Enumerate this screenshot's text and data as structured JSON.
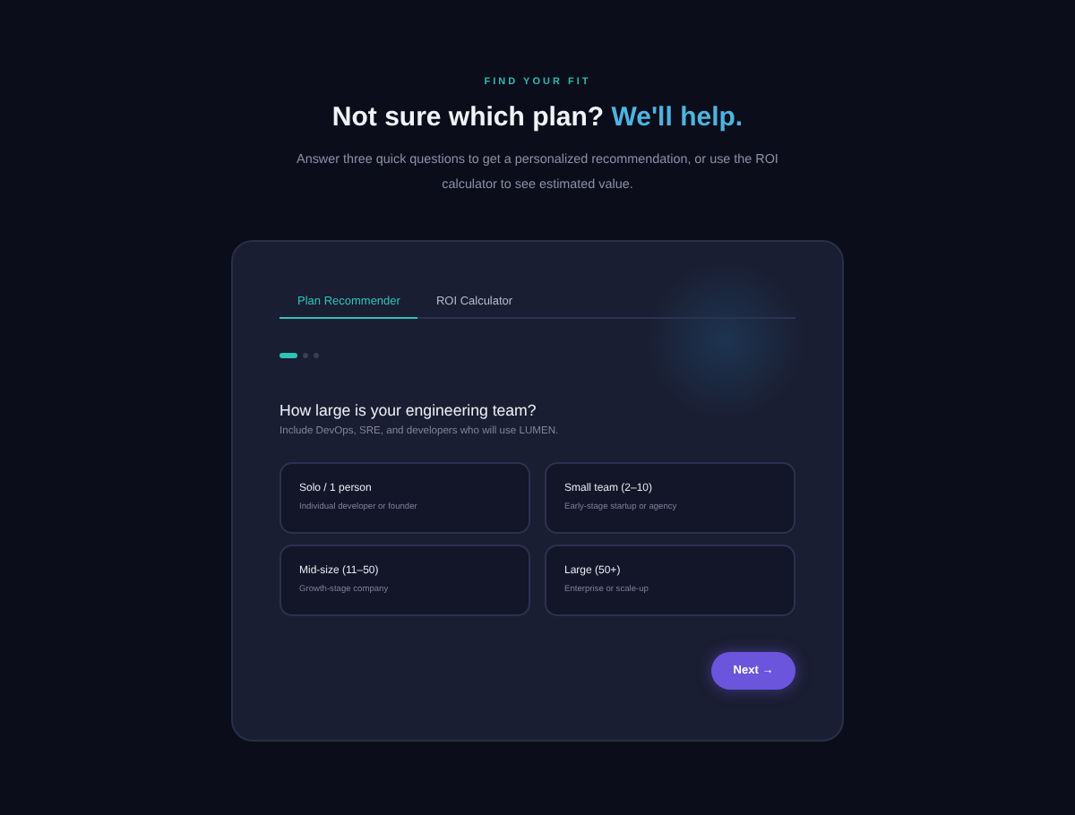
{
  "eyebrow": "FIND YOUR FIT",
  "title": "Not sure which plan?",
  "title_highlight": "We'll help.",
  "subtitle": "Answer three quick questions to get a personalized recommendation, or use the ROI calculator to see estimated value.",
  "tabs": [
    {
      "label": "Plan Recommender",
      "selected": true
    },
    {
      "label": "ROI Calculator",
      "selected": false
    }
  ],
  "steps": [
    {
      "selected": true
    },
    {
      "selected": false
    },
    {
      "selected": false
    }
  ],
  "question": "How large is your engineering team?",
  "hint": "Include DevOps, SRE, and developers who will use LUMEN.",
  "options": [
    {
      "label": "Solo / 1 person",
      "description": "Individual developer or founder",
      "selected": false
    },
    {
      "label": "Small team (2–10)",
      "description": "Early-stage startup or agency",
      "selected": false
    },
    {
      "label": "Mid-size (11–50)",
      "description": "Growth-stage company",
      "selected": false
    },
    {
      "label": "Large (50+)",
      "description": "Enterprise or scale-up",
      "selected": false
    }
  ],
  "next_button": "Next →"
}
